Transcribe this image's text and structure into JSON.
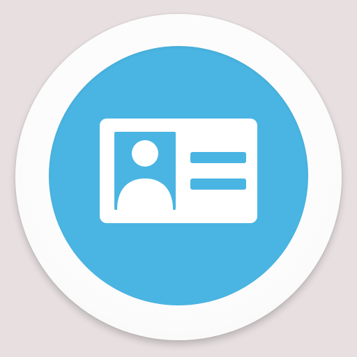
{
  "app_icon": {
    "name": "contact-card-app-icon",
    "icon": "id-card-icon",
    "colors": {
      "background": "#e7dfe0",
      "ring": "#ffffff",
      "disc": "#4ab5e2",
      "glyph": "#ffffff"
    }
  }
}
